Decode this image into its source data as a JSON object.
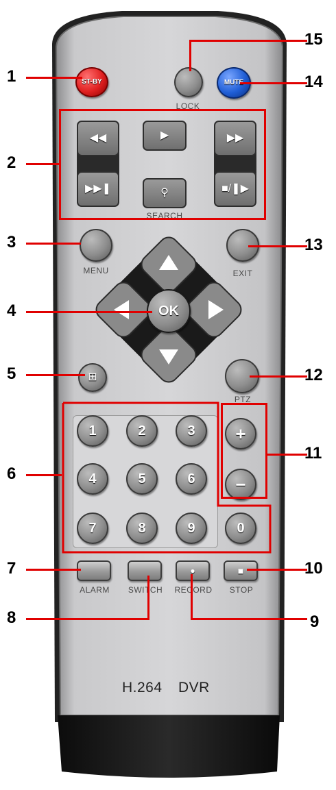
{
  "callouts": [
    "1",
    "2",
    "3",
    "4",
    "5",
    "6",
    "7",
    "8",
    "9",
    "10",
    "11",
    "12",
    "13",
    "14",
    "15"
  ],
  "buttons": {
    "stby": "ST-BY",
    "mute": "MUTE",
    "ok": "OK",
    "plus": "+",
    "minus": "−",
    "rec_dot": "●",
    "stop_sq": "■"
  },
  "labels": {
    "lock": "LOCK",
    "search": "SEARCH",
    "menu": "MENU",
    "exit": "EXIT",
    "ptz": "PTZ",
    "alarm": "ALARM",
    "switch": "SWITCH",
    "record": "RECORD",
    "stop": "STOP"
  },
  "numbers": [
    "1",
    "2",
    "3",
    "4",
    "5",
    "6",
    "7",
    "8",
    "9",
    "0"
  ],
  "branding": {
    "text1": "H.264",
    "text2": "DVR"
  },
  "icons": {
    "rewind": "rewind-icon",
    "play": "play-icon",
    "fast_forward": "fast-forward-icon",
    "next": "skip-next-icon",
    "search": "search-icon",
    "pause_step": "stop-step-icon",
    "up": "arrow-up-icon",
    "down": "arrow-down-icon",
    "left": "arrow-left-icon",
    "right": "arrow-right-icon",
    "multiscreen": "grid-icon"
  },
  "colors": {
    "body": "#c8c8ca",
    "stby_button": "#e02020",
    "mute_button": "#1f5ed6",
    "callout_line": "#e00000"
  }
}
